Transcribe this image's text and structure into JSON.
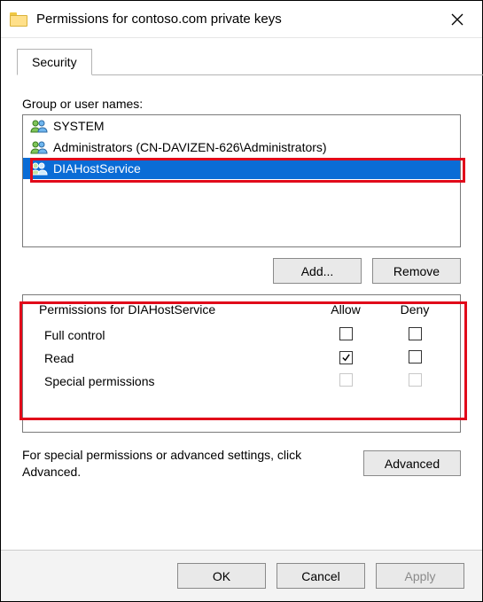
{
  "window": {
    "title": "Permissions for contoso.com private keys"
  },
  "tabs": {
    "security": "Security"
  },
  "section": {
    "group_label": "Group or user names:",
    "users": [
      {
        "name": "SYSTEM",
        "selected": false
      },
      {
        "name": "Administrators (CN-DAVIZEN-626\\Administrators)",
        "selected": false
      },
      {
        "name": "DIAHostService",
        "selected": true
      }
    ]
  },
  "buttons": {
    "add": "Add...",
    "remove": "Remove",
    "advanced": "Advanced",
    "ok": "OK",
    "cancel": "Cancel",
    "apply": "Apply"
  },
  "permissions": {
    "header_prefix": "Permissions for ",
    "header_subject": "DIAHostService",
    "allow": "Allow",
    "deny": "Deny",
    "rows": [
      {
        "name": "Full control",
        "allow": false,
        "deny": false,
        "enabled": true
      },
      {
        "name": "Read",
        "allow": true,
        "deny": false,
        "enabled": true
      },
      {
        "name": "Special permissions",
        "allow": false,
        "deny": false,
        "enabled": false
      }
    ]
  },
  "advanced_text": "For special permissions or advanced settings, click Advanced."
}
